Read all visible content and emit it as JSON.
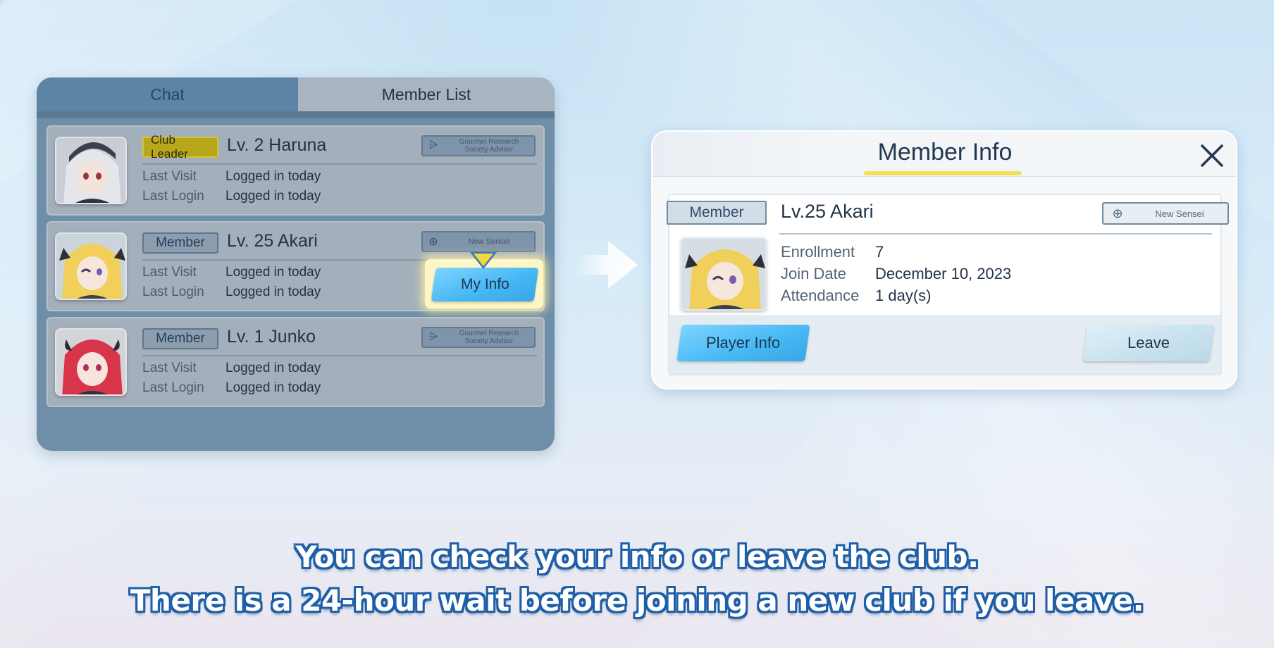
{
  "tabs": {
    "chat": "Chat",
    "member_list": "Member List"
  },
  "members": [
    {
      "role": "Club Leader",
      "name": "Lv. 2 Haruna",
      "title_lines": [
        "Gourmet Research",
        "Society Advisor"
      ],
      "last_visit_label": "Last Visit",
      "last_visit": "Logged in today",
      "last_login_label": "Last Login",
      "last_login": "Logged in today"
    },
    {
      "role": "Member",
      "name": "Lv. 25 Akari",
      "title_lines": [
        "New Sensei",
        ""
      ],
      "last_visit_label": "Last Visit",
      "last_visit": "Logged in today",
      "last_login_label": "Last Login",
      "last_login": "Logged in today"
    },
    {
      "role": "Member",
      "name": "Lv. 1 Junko",
      "title_lines": [
        "Gourmet Research",
        "Society Advisor"
      ],
      "last_visit_label": "Last Visit",
      "last_visit": "Logged in today",
      "last_login_label": "Last Login",
      "last_login": "Logged in today"
    }
  ],
  "my_info_button": "My Info",
  "dialog": {
    "title": "Member Info",
    "role": "Member",
    "name": "Lv.25 Akari",
    "title_badge": "New Sensei",
    "fields": [
      {
        "label": "Enrollment",
        "value": "7"
      },
      {
        "label": "Join Date",
        "value": "December 10, 2023"
      },
      {
        "label": "Attendance",
        "value": "1 day(s)"
      }
    ],
    "player_info_button": "Player Info",
    "leave_button": "Leave"
  },
  "caption": {
    "line1": "You can check your info or leave the club.",
    "line2": "There is a 24-hour wait before joining a new club if you leave."
  },
  "colors": {
    "accent_blue": "#44b6f3",
    "leader_badge": "#b9a71b",
    "title_underline": "#f4e15a",
    "caption_outline": "#1e5fa8"
  },
  "icons": [
    "close-icon",
    "arrow-right-icon",
    "crosshair-icon",
    "emblem-icon",
    "pointer-down-icon"
  ]
}
